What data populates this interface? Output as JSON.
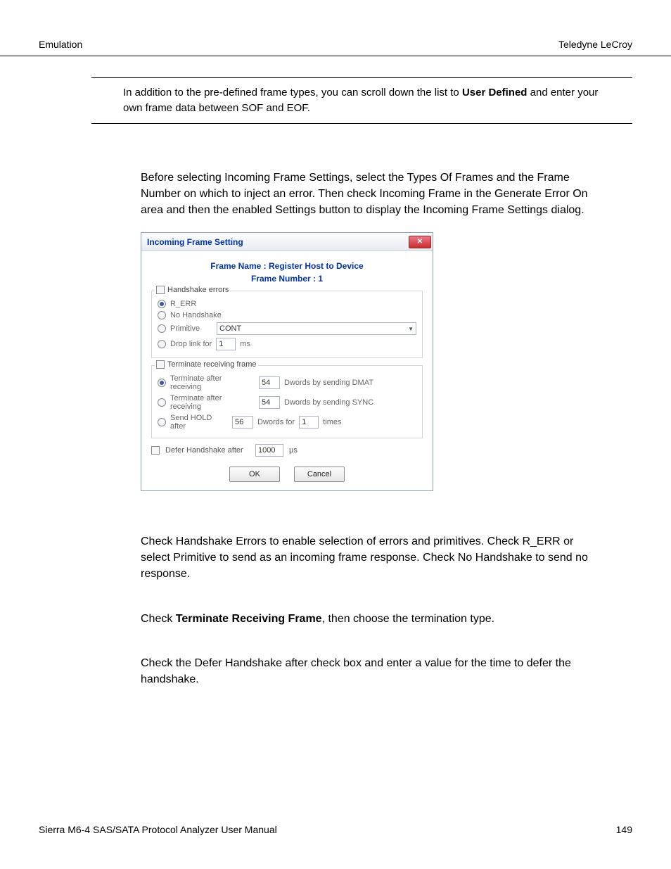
{
  "header": {
    "left": "Emulation",
    "right": "Teledyne LeCroy"
  },
  "intro_block": {
    "pre": "In addition to the pre-defined frame types, you can scroll down the list to ",
    "bold": "User Defined",
    "post": " and enter your own frame data between SOF and EOF."
  },
  "para1": "Before selecting Incoming Frame Settings, select the Types Of Frames and the Frame Number on which to inject an error. Then check Incoming Frame in the Generate Error On area and then the enabled Settings button to display the Incoming Frame Settings dialog.",
  "dialog": {
    "title": "Incoming Frame Setting",
    "frame_name_label": "Frame Name :",
    "frame_name_value": "Register Host to Device",
    "frame_number_label": "Frame Number :",
    "frame_number_value": "1",
    "handshake": {
      "legend": "Handshake errors",
      "r_err": "R_ERR",
      "no_handshake": "No Handshake",
      "primitive_label": "Primitive",
      "primitive_value": "CONT",
      "droplink_label": "Drop link for",
      "droplink_value": "1",
      "droplink_unit": "ms"
    },
    "terminate": {
      "legend": "Terminate receiving frame",
      "opt1_label": "Terminate after receiving",
      "opt1_value": "54",
      "opt1_suffix": "Dwords by sending DMAT",
      "opt2_label": "Terminate after receiving",
      "opt2_value": "54",
      "opt2_suffix": "Dwords by sending SYNC",
      "opt3_label": "Send HOLD after",
      "opt3_value1": "56",
      "opt3_mid": "Dwords for",
      "opt3_value2": "1",
      "opt3_suffix": "times"
    },
    "defer": {
      "label": "Defer Handshake after",
      "value": "1000",
      "unit": "µs"
    },
    "ok": "OK",
    "cancel": "Cancel"
  },
  "para2": "Check Handshake Errors to enable selection of errors and primitives. Check R_ERR or select Primitive to send as an incoming frame response. Check No Handshake to send no response.",
  "para3_pre": "Check ",
  "para3_bold": "Terminate Receiving Frame",
  "para3_post": ", then choose the termination type.",
  "para4": "Check the Defer Handshake after check box and enter a value for the time to defer the handshake.",
  "footer": {
    "left": "Sierra M6-4 SAS/SATA Protocol Analyzer User Manual",
    "right": "149"
  }
}
